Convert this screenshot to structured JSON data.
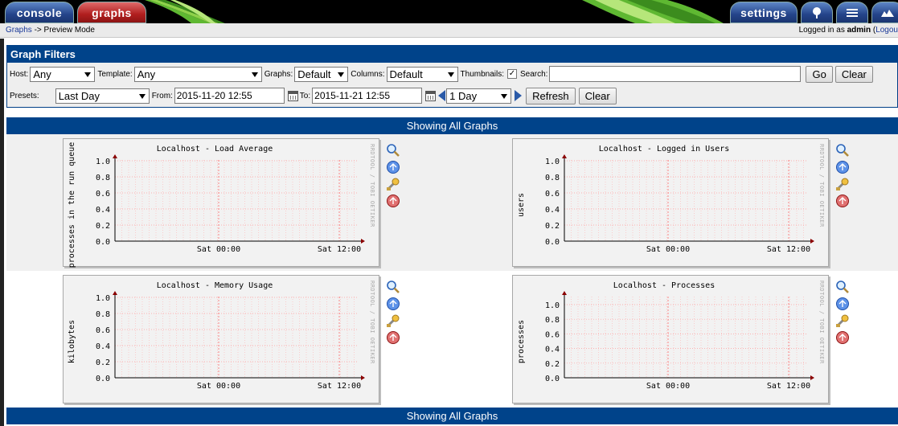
{
  "nav": {
    "console_label": "console",
    "graphs_label": "graphs",
    "settings_label": "settings",
    "tree_icon": "tree-icon",
    "list_icon": "list-icon",
    "preview_icon": "preview-icon"
  },
  "breadcrumb": {
    "link": "Graphs",
    "separator": " -> ",
    "current": "Preview Mode"
  },
  "login": {
    "prefix": "Logged in as ",
    "user": "admin",
    "logout_prefix": " (",
    "logout_label": "Logou"
  },
  "filters": {
    "title": "Graph Filters",
    "host_label": "Host:",
    "host_value": "Any",
    "template_label": "Template:",
    "template_value": "Any",
    "graphs_label": "Graphs:",
    "graphs_value": "Default",
    "columns_label": "Columns:",
    "columns_value": "Default",
    "thumbnails_label": "Thumbnails:",
    "thumbnails_checked": "✓",
    "search_label": "Search:",
    "search_value": "",
    "go_label": "Go",
    "clear_label": "Clear",
    "presets_label": "Presets:",
    "presets_value": "Last Day",
    "from_label": "From:",
    "from_value": "2015-11-20 12:55",
    "to_label": "To:",
    "to_value": "2015-11-21 12:55",
    "span_value": "1 Day",
    "refresh_label": "Refresh",
    "clear2_label": "Clear"
  },
  "showing_label": "Showing All Graphs",
  "graphs": [
    {
      "title": "Localhost - Load Average",
      "ylabel": "processes in the run queue",
      "yticks": [
        "1.0",
        "0.8",
        "0.6",
        "0.4",
        "0.2",
        "0.0"
      ],
      "xticks": [
        "Sat 00:00",
        "Sat 12:00"
      ],
      "watermark": "RRDTOOL / TOBI OETIKER"
    },
    {
      "title": "Localhost - Logged in Users",
      "ylabel": "users",
      "yticks": [
        "1.0",
        "0.8",
        "0.6",
        "0.4",
        "0.2",
        "0.0"
      ],
      "xticks": [
        "Sat 00:00",
        "Sat 12:00"
      ],
      "watermark": "RRDTOOL / TOBI OETIKER"
    },
    {
      "title": "Localhost - Memory Usage",
      "ylabel": "kilobytes",
      "yticks": [
        "1.0",
        "0.8",
        "0.6",
        "0.4",
        "0.2",
        "0.0"
      ],
      "xticks": [
        "Sat 00:00",
        "Sat 12:00"
      ],
      "watermark": "RRDTOOL / TOBI OETIKER"
    },
    {
      "title": "Localhost - Processes",
      "ylabel": "processes",
      "yticks": [
        "1.0",
        "0.8",
        "0.6",
        "0.4",
        "0.2",
        "0.0"
      ],
      "xticks": [
        "Sat 00:00",
        "Sat 12:00"
      ],
      "watermark": "RRDTOOL / TOBI OETIKER"
    }
  ],
  "graph_action_icons": [
    "zoom-icon",
    "info-icon",
    "edit-wrench-icon",
    "time-graph-icon"
  ],
  "colors": {
    "header_blue": "#00438a",
    "graph_tab_red": "#b01e1e",
    "console_tab_blue": "#24448a",
    "grid_red": "#ff9a9a",
    "axis_red": "#8b0000"
  }
}
